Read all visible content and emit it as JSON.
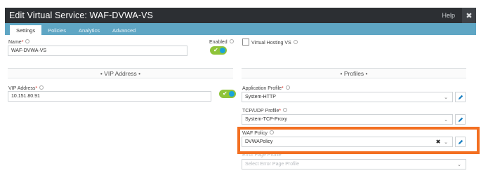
{
  "window": {
    "title": "Edit Virtual Service: WAF-DVWA-VS",
    "help_label": "Help",
    "close_glyph": "✖"
  },
  "tabs": [
    {
      "label": "Settings",
      "active": true
    },
    {
      "label": "Policies",
      "active": false
    },
    {
      "label": "Analytics",
      "active": false
    },
    {
      "label": "Advanced",
      "active": false
    }
  ],
  "form": {
    "name_label": "Name",
    "name_value": "WAF-DVWA-VS",
    "enabled_label": "Enabled",
    "enabled": true,
    "virtual_hosting_label": "Virtual Hosting VS",
    "virtual_hosting_checked": false
  },
  "vip": {
    "header": "• VIP Address •",
    "address_label": "VIP Address",
    "address_value": "10.151.80.91",
    "enabled": true
  },
  "profiles": {
    "header": "• Profiles •",
    "app_profile_label": "Application Profile",
    "app_profile_value": "System-HTTP",
    "tcp_profile_label": "TCP/UDP Profile",
    "tcp_profile_value": "System-TCP-Proxy",
    "waf_policy_label": "WAF Policy",
    "waf_policy_value": "DVWAPolicy",
    "error_page_label": "Error Page Profile",
    "error_page_placeholder": "Select Error Page Profile"
  },
  "colors": {
    "titlebar": "#2c2f33",
    "tabbar": "#5fa6c4",
    "toggle_on": "#8fc43a",
    "highlight": "#f36f21",
    "required": "#e2231a"
  },
  "icons": {
    "required_marker": "*",
    "check": "✔",
    "chevron": "⌄",
    "clear": "✖"
  }
}
